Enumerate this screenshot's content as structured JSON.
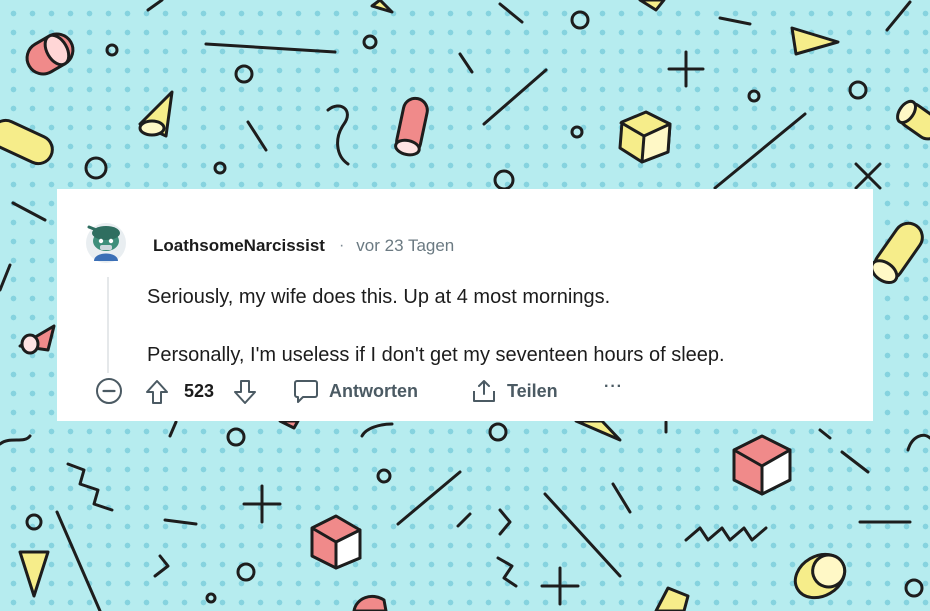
{
  "comment": {
    "username": "LoathsomeNarcissist",
    "separator": "·",
    "timestamp": "vor 23 Tagen",
    "paragraphs": [
      "Seriously, my wife does this. Up at 4 most mornings.",
      "Personally, I'm useless if I don't get my seventeen hours of sleep."
    ],
    "vote_count": "523",
    "actions": {
      "reply_label": "Antworten",
      "share_label": "Teilen",
      "more_label": "···"
    }
  },
  "icons": {
    "collapse": "minus-circle-icon",
    "upvote": "arrow-up-icon",
    "downvote": "arrow-down-icon",
    "reply": "speech-bubble-icon",
    "share": "share-icon",
    "more": "ellipsis-icon"
  },
  "colors": {
    "background": "#b6ecef",
    "dots": "#86d3df",
    "card": "#ffffff",
    "text": "#1c1c1c",
    "muted": "#6b7a82",
    "pink": "#f08a8a",
    "yellow": "#f6ed8a"
  }
}
